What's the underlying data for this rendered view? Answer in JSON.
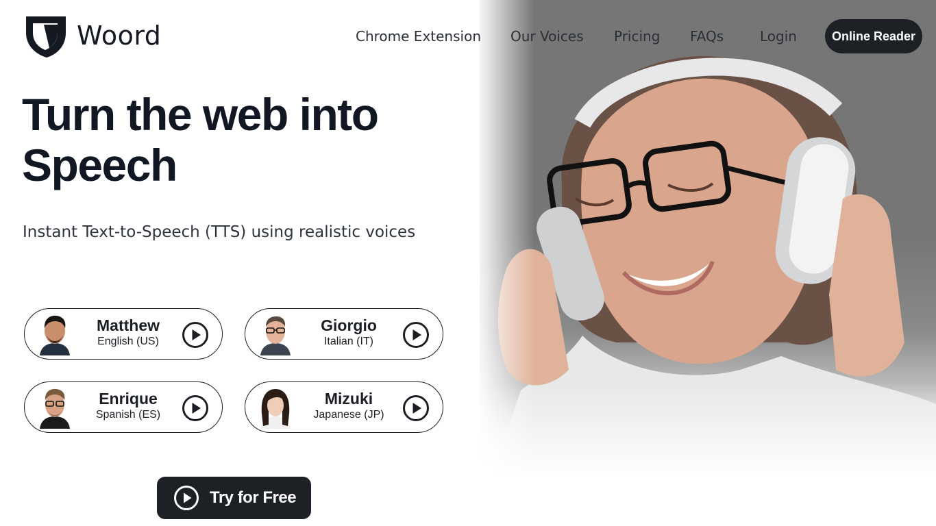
{
  "brand": {
    "name": "Woord",
    "logo_icon": "shield-logo-icon"
  },
  "nav": {
    "items": [
      {
        "label": "Chrome Extension"
      },
      {
        "label": "Our Voices"
      },
      {
        "label": "Pricing"
      },
      {
        "label": "FAQs"
      },
      {
        "label": "Login"
      }
    ],
    "cta_label": "Online Reader"
  },
  "hero": {
    "headline_line1": "Turn the web into",
    "headline_line2": "Speech",
    "subtitle": "Instant Text-to-Speech (TTS) using realistic voices",
    "image": "woman-with-headphones-photo"
  },
  "voices": [
    {
      "name": "Matthew",
      "language": "English (US)",
      "icon": "play-icon"
    },
    {
      "name": "Giorgio",
      "language": "Italian (IT)",
      "icon": "play-icon"
    },
    {
      "name": "Enrique",
      "language": "Spanish (ES)",
      "icon": "play-icon"
    },
    {
      "name": "Mizuki",
      "language": "Japanese (JP)",
      "icon": "play-icon"
    }
  ],
  "cta": {
    "label": "Try for Free",
    "icon": "play-icon"
  },
  "colors": {
    "dark": "#1d2126",
    "text": "#111723",
    "photo_bg": "#767676"
  }
}
